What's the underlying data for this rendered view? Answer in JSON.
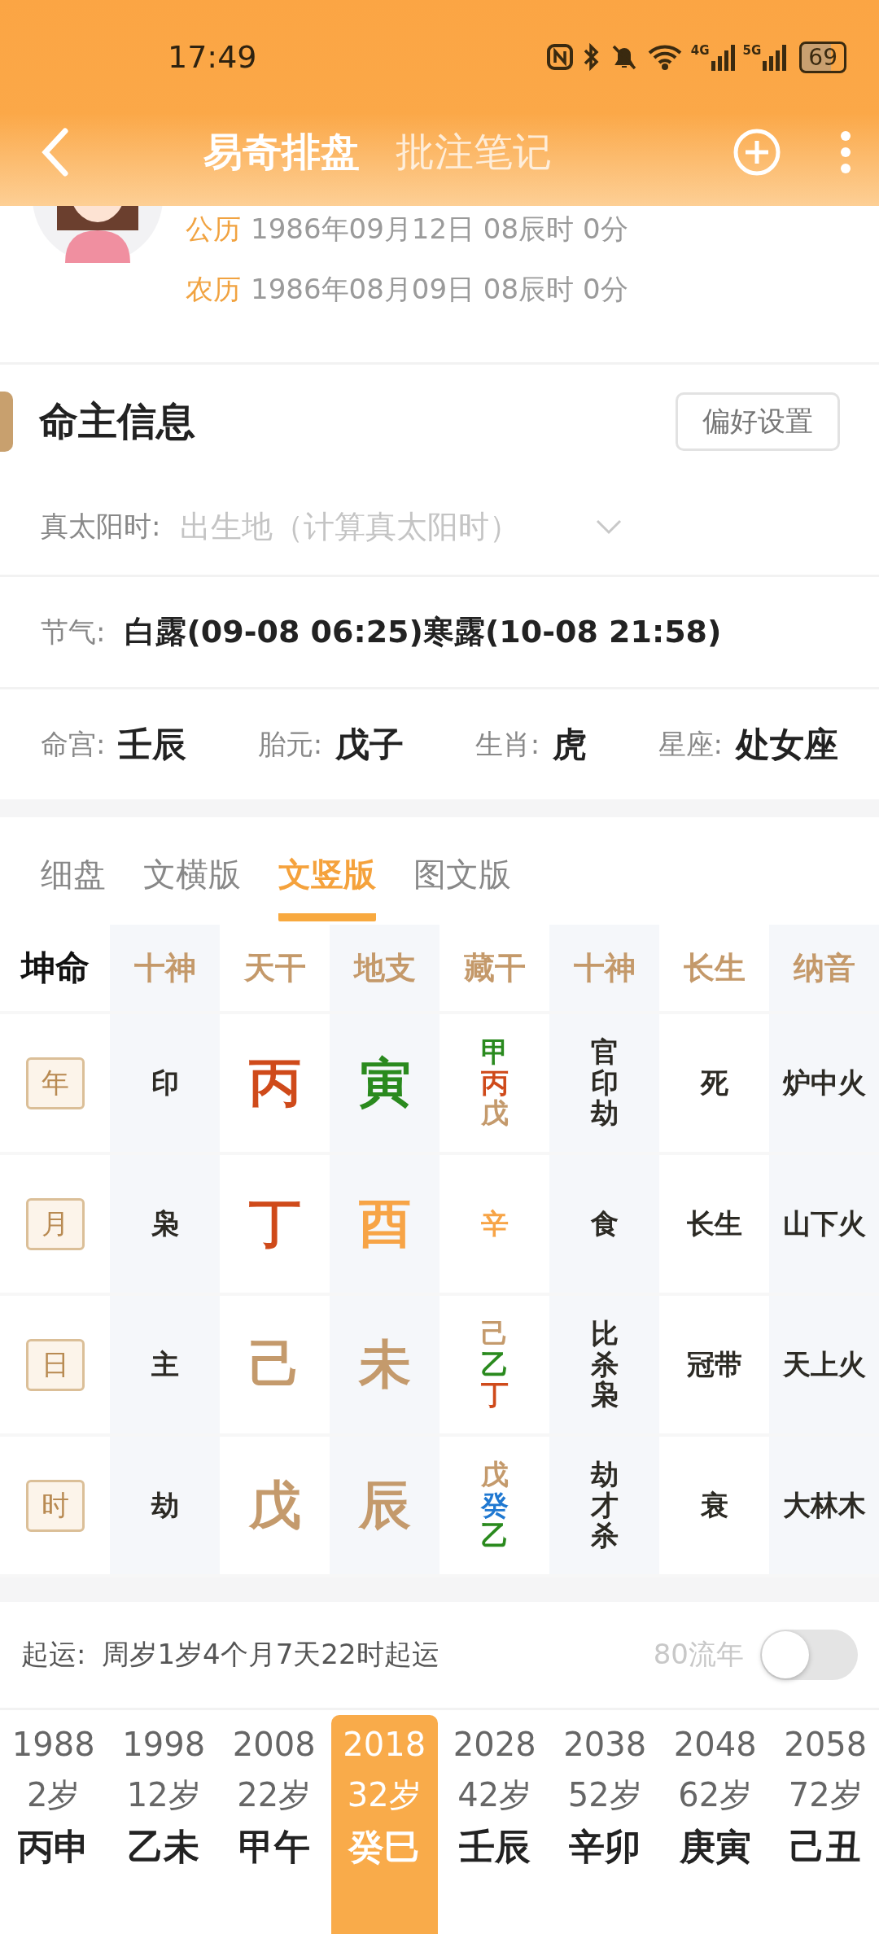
{
  "status_bar": {
    "time": "17:49",
    "network_labels": [
      "4G",
      "5G"
    ],
    "battery": "69"
  },
  "header": {
    "tabs": [
      {
        "label": "易奇排盘",
        "selected": true
      },
      {
        "label": "批注笔记",
        "selected": false
      }
    ]
  },
  "profile": {
    "dates": [
      {
        "label": "公历",
        "value": "1986年09月12日 08辰时 0分"
      },
      {
        "label": "农历",
        "value": "1986年08月09日 08辰时 0分"
      }
    ]
  },
  "info": {
    "title": "命主信息",
    "settings_button": "偏好设置",
    "solar_time": {
      "label": "真太阳时:",
      "placeholder": "出生地（计算真太阳时）"
    },
    "solar_terms": {
      "label": "节气:",
      "value": "白露(09-08 06:25)寒露(10-08 21:58)"
    },
    "attributes": [
      {
        "label": "命宫:",
        "value": "壬辰"
      },
      {
        "label": "胎元:",
        "value": "戊子"
      },
      {
        "label": "生肖:",
        "value": "虎"
      },
      {
        "label": "星座:",
        "value": "处女座"
      }
    ]
  },
  "view_tabs": [
    {
      "label": "细盘",
      "selected": false
    },
    {
      "label": "文横版",
      "selected": false
    },
    {
      "label": "文竖版",
      "selected": true
    },
    {
      "label": "图文版",
      "selected": false
    }
  ],
  "chart": {
    "corner": "坤命",
    "columns": [
      "十神",
      "天干",
      "地支",
      "藏干",
      "十神",
      "长生",
      "纳音"
    ],
    "rows": [
      {
        "pillar": "年",
        "ten_god": "印",
        "stem": {
          "text": "丙",
          "color": "#cf4a1a"
        },
        "branch": {
          "text": "寅",
          "color": "#2a8a1e"
        },
        "hidden": [
          {
            "text": "甲",
            "color": "#2a8a1e"
          },
          {
            "text": "丙",
            "color": "#cf4a1a"
          },
          {
            "text": "戊",
            "color": "#c49a6c"
          }
        ],
        "hidden_gods": "官印劫",
        "growth": "死",
        "nayin": "炉中火"
      },
      {
        "pillar": "月",
        "ten_god": "枭",
        "stem": {
          "text": "丁",
          "color": "#cf4a1a"
        },
        "branch": {
          "text": "酉",
          "color": "#f7a446"
        },
        "hidden": [
          {
            "text": "辛",
            "color": "#f7a446"
          }
        ],
        "hidden_gods": "食",
        "growth": "长生",
        "nayin": "山下火"
      },
      {
        "pillar": "日",
        "ten_god": "主",
        "stem": {
          "text": "己",
          "color": "#c49a6c"
        },
        "branch": {
          "text": "未",
          "color": "#c49a6c"
        },
        "hidden": [
          {
            "text": "己",
            "color": "#c49a6c"
          },
          {
            "text": "乙",
            "color": "#2a8a1e"
          },
          {
            "text": "丁",
            "color": "#cf4a1a"
          }
        ],
        "hidden_gods": "比杀枭",
        "growth": "冠带",
        "nayin": "天上火"
      },
      {
        "pillar": "时",
        "ten_god": "劫",
        "stem": {
          "text": "戊",
          "color": "#c49a6c"
        },
        "branch": {
          "text": "辰",
          "color": "#c49a6c"
        },
        "hidden": [
          {
            "text": "戊",
            "color": "#c49a6c"
          },
          {
            "text": "癸",
            "color": "#1f78d1"
          },
          {
            "text": "乙",
            "color": "#2a8a1e"
          }
        ],
        "hidden_gods": "劫才杀",
        "growth": "衰",
        "nayin": "大林木"
      }
    ]
  },
  "luck": {
    "label": "起运:",
    "value": "周岁1岁4个月7天22时起运",
    "toggle": {
      "label": "80流年",
      "on": false
    },
    "periods": [
      {
        "year": "1988",
        "age": "2岁",
        "pillar": "丙申",
        "selected": false
      },
      {
        "year": "1998",
        "age": "12岁",
        "pillar": "乙未",
        "selected": false
      },
      {
        "year": "2008",
        "age": "22岁",
        "pillar": "甲午",
        "selected": false
      },
      {
        "year": "2018",
        "age": "32岁",
        "pillar": "癸巳",
        "selected": true
      },
      {
        "year": "2028",
        "age": "42岁",
        "pillar": "壬辰",
        "selected": false
      },
      {
        "year": "2038",
        "age": "52岁",
        "pillar": "辛卯",
        "selected": false
      },
      {
        "year": "2048",
        "age": "62岁",
        "pillar": "庚寅",
        "selected": false
      },
      {
        "year": "2058",
        "age": "72岁",
        "pillar": "己丑",
        "selected": false
      }
    ]
  }
}
